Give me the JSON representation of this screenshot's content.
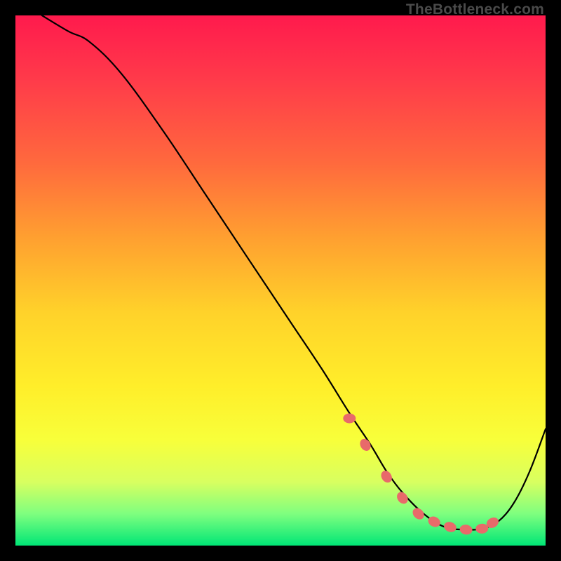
{
  "watermark": "TheBottleneck.com",
  "chart_data": {
    "type": "line",
    "title": "",
    "xlabel": "",
    "ylabel": "",
    "xlim": [
      0,
      100
    ],
    "ylim": [
      0,
      100
    ],
    "series": [
      {
        "name": "curve",
        "x": [
          5,
          10,
          14,
          20,
          28,
          36,
          44,
          52,
          58,
          63,
          67,
          70,
          73,
          77,
          81,
          85,
          88,
          91,
          94,
          97,
          100
        ],
        "y": [
          100,
          97,
          95,
          89,
          78,
          66,
          54,
          42,
          33,
          25,
          19,
          14,
          10,
          6,
          3.5,
          3,
          3.2,
          4.5,
          8,
          14,
          22
        ]
      }
    ],
    "markers": {
      "name": "dots",
      "x": [
        63,
        66,
        70,
        73,
        76,
        79,
        82,
        85,
        88,
        90
      ],
      "y": [
        24,
        19,
        13,
        9,
        6,
        4.5,
        3.5,
        3,
        3.2,
        4.3
      ]
    },
    "gradient_domain": "bottleneck-percent",
    "note": "Values are visual estimates; axes are not labeled in the source image."
  }
}
